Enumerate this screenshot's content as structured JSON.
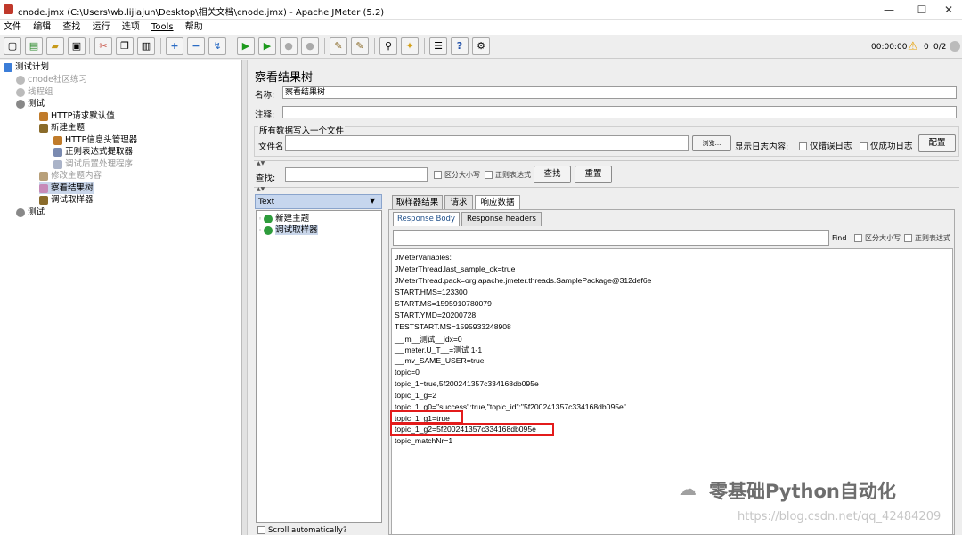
{
  "window": {
    "title": "cnode.jmx (C:\\Users\\wb.lijiajun\\Desktop\\相关文档\\cnode.jmx) - Apache JMeter (5.2)",
    "min": "—",
    "max": "☐",
    "close": "✕"
  },
  "menu": [
    "文件",
    "编辑",
    "查找",
    "运行",
    "选项",
    "Tools",
    "帮助"
  ],
  "status": {
    "time": "00:00:00",
    "warnings": "0",
    "threads": "0/2"
  },
  "tree": {
    "root": "测试计划",
    "items": [
      "cnode社区练习",
      "线程组",
      "测试",
      "HTTP请求默认值",
      "新建主题",
      "HTTP信息头管理器",
      "正则表达式提取器",
      "调试后置处理程序",
      "修改主题内容",
      "察看结果树",
      "调试取样器",
      "测试"
    ]
  },
  "panel": {
    "heading": "察看结果树",
    "name_label": "名称:",
    "name_value": "察看结果树",
    "comment_label": "注释:",
    "group_title": "所有数据写入一个文件",
    "file_label": "文件名",
    "browse": "浏览...",
    "log_label": "显示日志内容:",
    "only_errors": "仅错误日志",
    "only_success": "仅成功日志",
    "config": "配置"
  },
  "search": {
    "label": "查找:",
    "case": "区分大小写",
    "regex": "正则表达式",
    "find_btn": "查找",
    "reset_btn": "重置"
  },
  "renderer": {
    "selected": "Text",
    "items": [
      "新建主题",
      "调试取样器"
    ],
    "scroll": "Scroll automatically?"
  },
  "tabs": {
    "sampler": "取样器结果",
    "request": "请求",
    "response": "响应数据",
    "body": "Response Body",
    "headers": "Response headers"
  },
  "find": {
    "button": "Find",
    "case": "区分大小写",
    "regex": "正则表达式"
  },
  "response_lines": [
    "JMeterVariables:",
    "JMeterThread.last_sample_ok=true",
    "JMeterThread.pack=org.apache.jmeter.threads.SamplePackage@312def6e",
    "START.HMS=123300",
    "START.MS=1595910780079",
    "START.YMD=20200728",
    "TESTSTART.MS=1595933248908",
    "__jm__测试__idx=0",
    "__jmeter.U_T__=测试 1-1",
    "__jmv_SAME_USER=true",
    "topic=0",
    "topic_1=true,5f200241357c334168db095e",
    "topic_1_g=2",
    "topic_1_g0=\"success\":true,\"topic_id\":\"5f200241357c334168db095e\"",
    "topic_1_g1=true",
    "topic_1_g2=5f200241357c334168db095e",
    "topic_matchNr=1"
  ],
  "watermark": {
    "brand": "零基础Python自动化",
    "url": "https://blog.csdn.net/qq_42484209"
  }
}
